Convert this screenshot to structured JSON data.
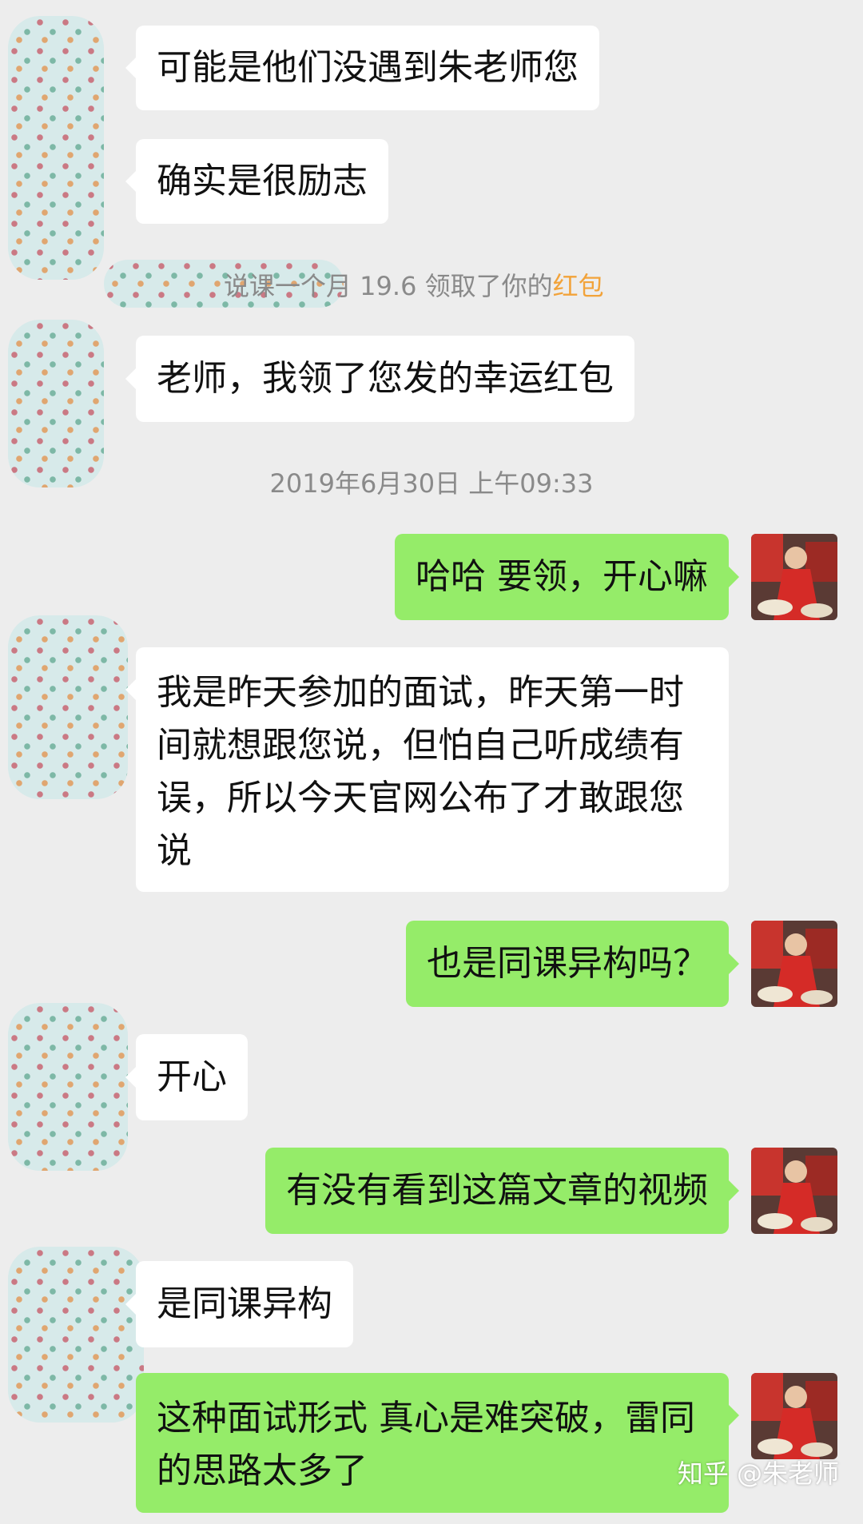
{
  "colors": {
    "background": "#ededed",
    "incoming_bubble": "#ffffff",
    "outgoing_bubble": "#95ec69",
    "system_text": "#8a8a8a",
    "red_packet_link": "#f2a33a"
  },
  "messages": [
    {
      "side": "incoming",
      "text": "可能是他们没遇到朱老师您"
    },
    {
      "side": "incoming",
      "text": "确实是很励志"
    },
    {
      "side": "system",
      "text": "说课一个月 19.6 领取了你的",
      "highlight": "红包"
    },
    {
      "side": "incoming",
      "text": "老师，我领了您发的幸运红包"
    },
    {
      "side": "timestamp",
      "text": "2019年6月30日 上午09:33"
    },
    {
      "side": "outgoing",
      "text": "哈哈 要领，开心嘛"
    },
    {
      "side": "incoming",
      "text": "我是昨天参加的面试，昨天第一时间就想跟您说，但怕自己听成绩有误，所以今天官网公布了才敢跟您说"
    },
    {
      "side": "outgoing",
      "text": "也是同课异构吗？"
    },
    {
      "side": "incoming",
      "text": "开心"
    },
    {
      "side": "outgoing",
      "text": "有没有看到这篇文章的视频"
    },
    {
      "side": "incoming",
      "text": "是同课异构"
    },
    {
      "side": "outgoing",
      "text": "这种面试形式 真心是难突破，雷同的思路太多了"
    }
  ],
  "icons": {
    "incoming_avatar": "blurred-avatar-icon",
    "outgoing_avatar": "teacher-avatar-icon"
  },
  "watermark": "知乎 @朱老师"
}
